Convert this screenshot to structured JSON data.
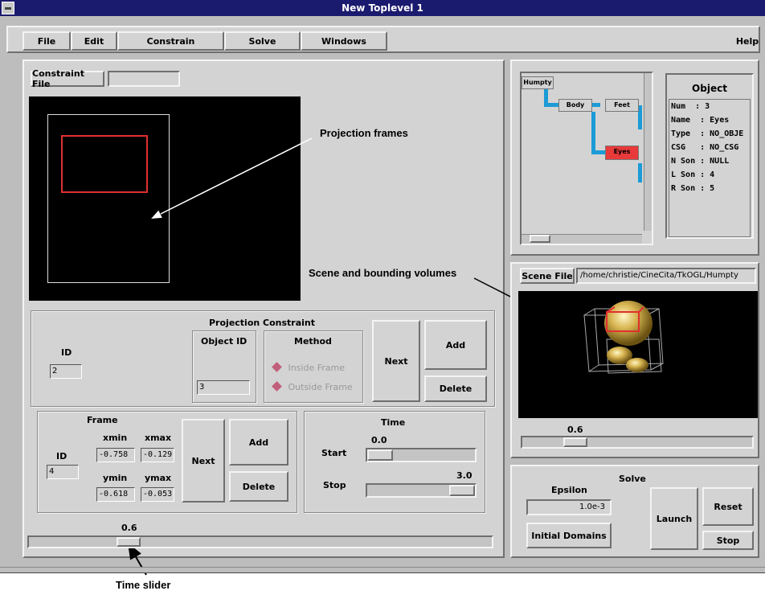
{
  "window": {
    "title": "New Toplevel 1"
  },
  "menu": {
    "file": "File",
    "edit": "Edit",
    "constrain": "Constrain",
    "solve": "Solve",
    "windows": "Windows",
    "help": "Help"
  },
  "constraint_file": {
    "label": "Constraint File",
    "value": ""
  },
  "annotations": {
    "projection_frames": "Projection frames",
    "scene_and_bounding": "Scene and bounding volumes",
    "time_slider": "Time slider"
  },
  "projection_constraint": {
    "title": "Projection Constraint",
    "id_label": "ID",
    "id_value": "2",
    "object_id_label": "Object ID",
    "object_id_value": "3",
    "method_label": "Method",
    "method_inside": "Inside Frame",
    "method_outside": "Outside Frame",
    "next": "Next",
    "add": "Add",
    "delete": "Delete"
  },
  "frame": {
    "title": "Frame",
    "id_label": "ID",
    "id_value": "4",
    "xmin_label": "xmin",
    "xmax_label": "xmax",
    "ymin_label": "ymin",
    "ymax_label": "ymax",
    "xmin_value": "-0.758",
    "xmax_value": "-0.129",
    "ymin_value": "-0.618",
    "ymax_value": "-0.053",
    "next": "Next",
    "add": "Add",
    "delete": "Delete"
  },
  "time": {
    "title": "Time",
    "start_label": "Start",
    "start_value": "0.0",
    "start_level": 0.0,
    "stop_label": "Stop",
    "stop_value": "3.0",
    "stop_level": 1.0
  },
  "bottom_slider": {
    "value": "0.6",
    "level": 0.2
  },
  "tree": {
    "nodes": {
      "humpty": "Humpty",
      "body": "Body",
      "feet": "Feet",
      "eyes": "Eyes"
    }
  },
  "object": {
    "title": "Object",
    "lines": [
      "Num  : 3",
      "Name  : Eyes",
      "Type  : NO_OBJE",
      "CSG   : NO_CSG",
      "N Son : NULL",
      "L Son : 4",
      "R Son : 5"
    ]
  },
  "scene_file": {
    "label": "Scene File",
    "value": "/home/christie/CineCita/TkOGL/Humpty"
  },
  "scene_slider": {
    "value": "0.6",
    "level": 0.2
  },
  "solve": {
    "title": "Solve",
    "epsilon_label": "Epsilon",
    "epsilon_value": "1.0e-3",
    "initial_domains": "Initial Domains",
    "launch": "Launch",
    "reset": "Reset",
    "stop": "Stop"
  },
  "colors": {
    "titlebar": "#1a1a6e",
    "frame_red": "#e03030",
    "connector": "#1c9bd6",
    "selected_node": "#e83a3a"
  }
}
